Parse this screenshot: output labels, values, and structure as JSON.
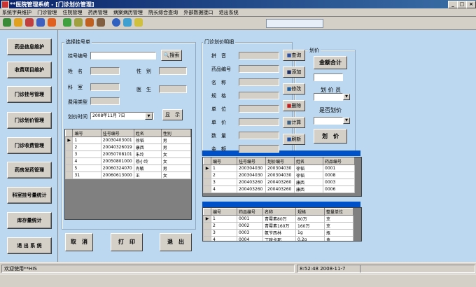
{
  "window": {
    "title": "**医院管理系统 - [门诊划价管理]",
    "min": "_",
    "max": "□",
    "close": "×"
  },
  "menu": [
    "系统字典维护",
    "门诊管理",
    "住院管理",
    "药房管理",
    "病案病历管理",
    "院长综合查询",
    "外部数据接口",
    "退出系统"
  ],
  "nav": [
    "药品信息维护",
    "收费项目维护",
    "门诊挂号管理",
    "门诊划价管理",
    "门诊收费管理",
    "药房发药管理",
    "科室挂号量统计",
    "库存量统计",
    "退 出 系 统"
  ],
  "left_group": {
    "title": "选择挂号单",
    "reg_label": "挂号编号",
    "search_btn": "搜索",
    "name_label": "姓　名",
    "gender_label": "性　别",
    "dept_label": "科　室",
    "doctor_label": "医　生",
    "fee_label": "费用类型",
    "date_label": "划价时间",
    "date_value": "2008年11月 7日",
    "show_btn": "显　示"
  },
  "reg_table": {
    "headers": [
      "编号",
      "挂号编号",
      "姓名",
      "性别"
    ],
    "rows": [
      [
        "1",
        "20030403001",
        "徐韬",
        "男"
      ],
      [
        "2",
        "20040326019",
        "康西",
        "男"
      ],
      [
        "3",
        "20050708101",
        "朱玲",
        "女"
      ],
      [
        "4",
        "20050801000",
        "杨小玲",
        "女"
      ],
      [
        "5",
        "20060324070",
        "肖敏",
        "男"
      ],
      [
        "31",
        "20060613000",
        "王",
        "女"
      ]
    ]
  },
  "mid_group": {
    "title": "门诊划价明细",
    "fields": [
      "拼　音",
      "药品编号",
      "名　称",
      "规　格",
      "单　位",
      "单　价",
      "数　量",
      "金　额"
    ],
    "buttons": [
      "查询",
      "添加",
      "修改",
      "删除",
      "计算",
      "刷新"
    ]
  },
  "right_group": {
    "title": "划价",
    "total_btn": "金额合计",
    "cashier_label": "划 价 员",
    "priced_label": "是否划价",
    "price_btn": "划　价"
  },
  "detail_table": {
    "headers": [
      "编号",
      "挂号编号",
      "划价编号",
      "姓名",
      "药品编号"
    ],
    "rows": [
      [
        "1",
        "200304030",
        "200304030",
        "徐韬",
        "0001"
      ],
      [
        "2",
        "200304030",
        "200304030",
        "徐韬",
        "0008"
      ],
      [
        "3",
        "200403260",
        "200403260",
        "康西",
        "0003"
      ],
      [
        "4",
        "200403260",
        "200403260",
        "康西",
        "0006"
      ]
    ]
  },
  "drug_table": {
    "headers": [
      "编号",
      "药品编号",
      "名称",
      "规格",
      "整量单位"
    ],
    "rows": [
      [
        "1",
        "0001",
        "青霉素80万",
        "80万",
        "支"
      ],
      [
        "2",
        "0002",
        "青霉素160万",
        "160万",
        "支"
      ],
      [
        "3",
        "0003",
        "氨苄西林",
        "1g",
        "瓶"
      ],
      [
        "4",
        "0004",
        "丁胺卡那",
        "0.2g",
        "盒"
      ]
    ]
  },
  "actions": {
    "cancel": "取　消",
    "print": "打　印",
    "exit": "退　出"
  },
  "status": {
    "welcome": "欢迎使用**HIS",
    "clock": "8:52:48  2008-11-7"
  },
  "colors": {
    "panel": "#bcd8f0",
    "title": "#0a246a",
    "highlight": "#0050c8"
  }
}
